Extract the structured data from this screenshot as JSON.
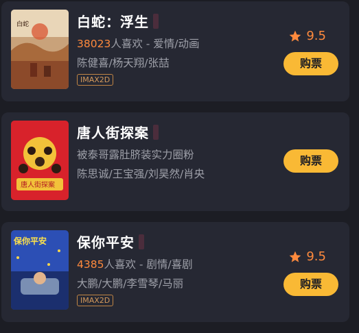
{
  "movies": [
    {
      "title": "白蛇：浮生",
      "want_count": "38023",
      "want_suffix": "人喜欢",
      "genre_sep": " - ",
      "genres": "爱情/动画",
      "cast": "陈健喜/杨天翔/张喆",
      "format_tag": "IMAX2D",
      "rating": "9.5",
      "buy_label": "购票"
    },
    {
      "title": "唐人街探案",
      "tagline": "被泰哥露肚脐装实力圈粉",
      "cast": "陈思诚/王宝强/刘昊然/肖央",
      "buy_label": "购票"
    },
    {
      "title": "保你平安",
      "want_count": "4385",
      "want_suffix": "人喜欢",
      "genre_sep": " - ",
      "genres": "剧情/喜剧",
      "cast": "大鹏/大鹏/李雪琴/马丽",
      "format_tag": "IMAX2D",
      "rating": "9.5",
      "buy_label": "购票"
    }
  ],
  "posters": {
    "baishe_text": "白蛇",
    "tangren_text": "唐人街探案",
    "baoni_text": "保你平安"
  },
  "colors": {
    "background": "#1c1d24",
    "card": "#262833",
    "accent_orange": "#ff8a3d",
    "button_yellow": "#f9b935"
  },
  "icons": {
    "rating": "star-icon"
  }
}
